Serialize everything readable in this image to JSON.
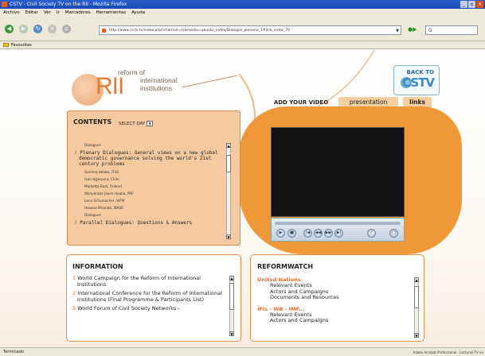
{
  "window": {
    "title": "CSTV - Civil Society TV on the RII - Mozilla Firefox"
  },
  "menu": [
    "Archivo",
    "Editar",
    "Ver",
    "Ir",
    "Marcadores",
    "Herramientas",
    "Ayuda"
  ],
  "nav": {
    "url": "http://www.cs-tv.tv/index.php?channel=rii&media=ubuntu_index/Dialogos_plenaria_1#link_index_70",
    "search_placeholder": ""
  },
  "bookmarks": {
    "label": "Favourites"
  },
  "logo": {
    "big": "RII",
    "line1": "reform of",
    "line2": "international",
    "line3": "institutions"
  },
  "back": {
    "line1": "BACK TO",
    "line2": "CSTV"
  },
  "tabs": {
    "add_video": "ADD YOUR VIDEO",
    "presentation": "presentation",
    "links": "links"
  },
  "contents": {
    "title": "CONTENTS",
    "select": "SELECT DAY",
    "items": [
      {
        "type": "sub",
        "text": "Dialogues"
      },
      {
        "type": "main",
        "num": "2",
        "text": "Plenary Dialogues: General views on a new global democratic governance solving the world's 21st century problems"
      },
      {
        "type": "sub",
        "text": "Gemma Adaba, ITUC"
      },
      {
        "type": "sub",
        "text": "Ivan Hgaspora, Chile"
      },
      {
        "type": "sub",
        "text": "Marketta Rast, Finland"
      },
      {
        "type": "sub",
        "text": "Wanyaraba Jaune Hoaka, PAP"
      },
      {
        "type": "sub",
        "text": "Lena Schumacher, WFM"
      },
      {
        "type": "sub",
        "text": "Hosana Miranda, IBASE"
      },
      {
        "type": "sub",
        "text": "Dialogues"
      },
      {
        "type": "main",
        "num": "3",
        "text": "Parallel Dialogues: Questions & Answers"
      }
    ]
  },
  "information": {
    "title": "INFORMATION",
    "items": [
      {
        "num": "1",
        "text": "World Campaign for the Reform of International Institutions"
      },
      {
        "num": "2",
        "text": "International Conference for the Reform of International Institutions (Final Programme & Participants List)"
      },
      {
        "num": "3",
        "text": "World Forum of Civil Society Networks -"
      }
    ]
  },
  "reformwatch": {
    "title": "REFORMWATCH",
    "groups": [
      {
        "heading": "United Nations",
        "items": [
          "Relevant Events",
          "Actors and Campaigns",
          "Documents and Resources"
        ]
      },
      {
        "heading": "IFIs - WB - IMF...",
        "items": [
          "Relevant Events",
          "Actors and Campaigns"
        ]
      }
    ]
  },
  "player": {
    "controls": [
      "play",
      "stop",
      "prev",
      "rewind",
      "forward",
      "next",
      "mute",
      "fullscreen"
    ]
  },
  "status": {
    "left": "Terminado",
    "right": "Adobe Acrobat Professional - Lecturas TV en"
  },
  "colors": {
    "accent": "#f09838",
    "panel": "#f6caa0",
    "link_number": "#e07020",
    "titlebar": "#1a49b8"
  }
}
